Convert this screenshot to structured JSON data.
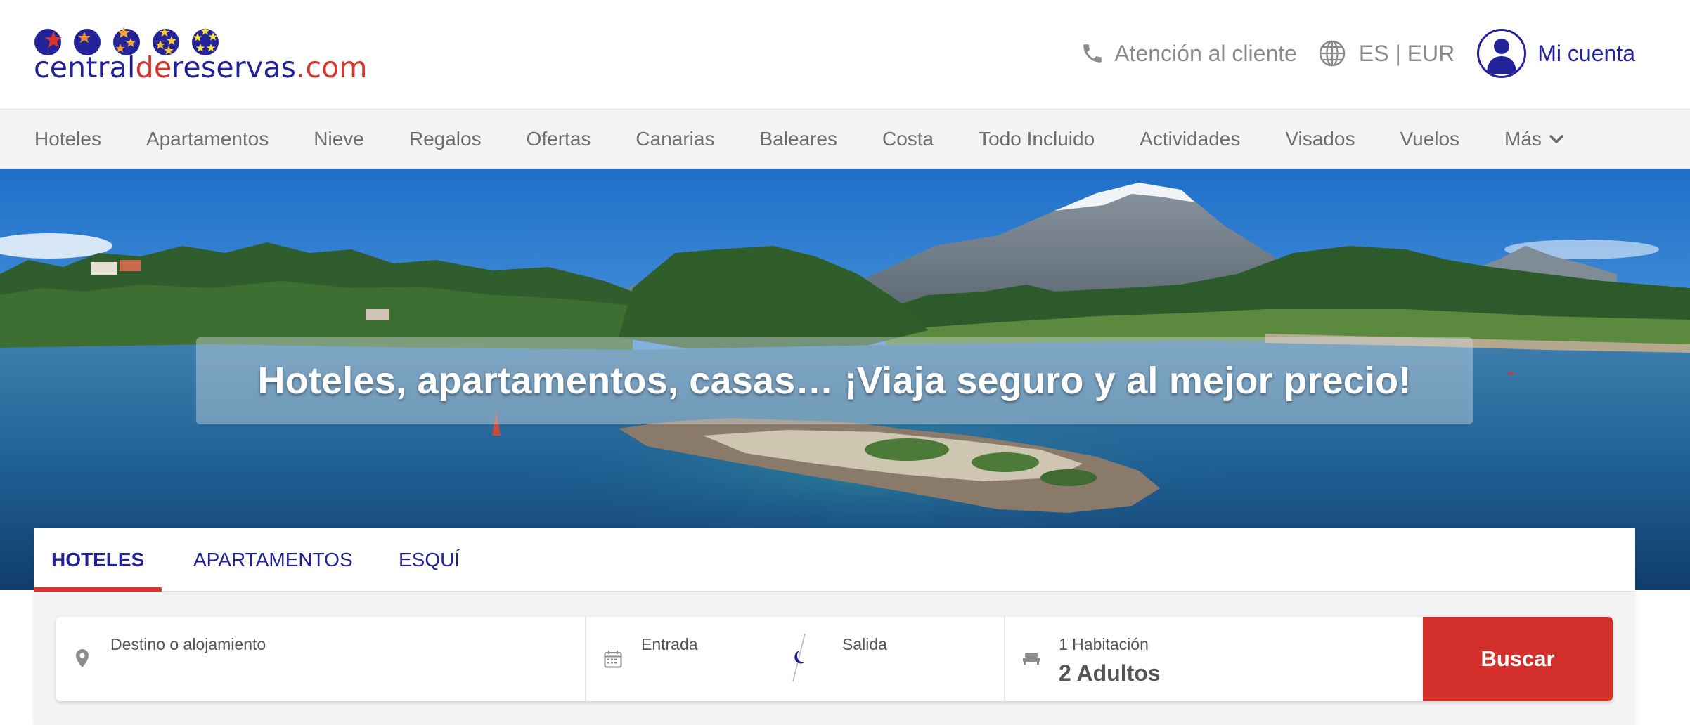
{
  "header": {
    "logo": {
      "part1": "central",
      "part2": "de",
      "part3": "reservas",
      "part4": ".com"
    },
    "customer_service": "Atención al cliente",
    "lang_currency": "ES | EUR",
    "account": "Mi cuenta"
  },
  "nav": {
    "items": [
      "Hoteles",
      "Apartamentos",
      "Nieve",
      "Regalos",
      "Ofertas",
      "Canarias",
      "Baleares",
      "Costa",
      "Todo Incluido",
      "Actividades",
      "Visados",
      "Vuelos",
      "Más"
    ]
  },
  "hero": {
    "title": "Hoteles, apartamentos, casas… ¡Viaja seguro y al mejor precio!"
  },
  "search": {
    "tabs": [
      "HOTELES",
      "APARTAMENTOS",
      "ESQUÍ"
    ],
    "active_tab": "HOTELES",
    "destination_label": "Destino o alojamiento",
    "checkin_label": "Entrada",
    "checkout_label": "Salida",
    "rooms_label": "1 Habitación",
    "guests_value": "2 Adultos",
    "submit_label": "Buscar"
  },
  "icons": {
    "logo_stars": "five-colored-star-circles",
    "customer_service": "phone-icon",
    "language": "globe-icon",
    "account": "user-icon",
    "more": "chevron-down-icon",
    "destination": "map-pin-icon",
    "checkin": "calendar-icon",
    "nights": "moon-icon",
    "rooms": "bed-icon"
  },
  "colors": {
    "brand_blue": "#22229a",
    "brand_red": "#d9342b",
    "button_red": "#d3302b",
    "nav_bg": "#f4f4f4",
    "muted_text": "#8a8a8a"
  }
}
